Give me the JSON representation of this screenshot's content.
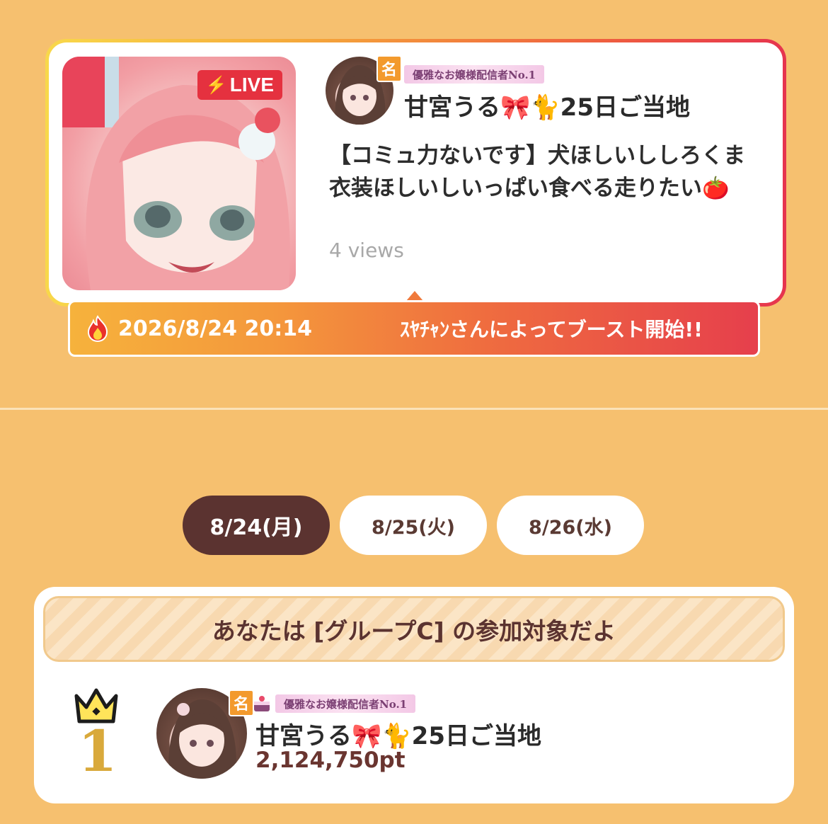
{
  "colors": {
    "background": "#f6c06f",
    "live_red": "#e5313f",
    "active_tab": "#5b3330",
    "rank_gold": "#d9a93b"
  },
  "stream": {
    "live_label": "LIVE",
    "live_icon": "lightning-bolt-icon",
    "badge_icon_text": "名",
    "title_badge": "優雅なお嬢様配信者No.1",
    "streamer_name": "甘宮うる🎀🐈25日ご当地",
    "description": "【コミュ力ないです】犬ほしいししろくま衣装ほしいしいっぱい食べる走りたい🍅",
    "views": "4 views"
  },
  "boost": {
    "icon": "fire-icon",
    "datetime": "2026/8/24 20:14",
    "message": "ｽﾔﾁｬﾝさんによってブースト開始!!"
  },
  "tabs": [
    {
      "label": "8/24(月)",
      "active": true
    },
    {
      "label": "8/25(火)",
      "active": false
    },
    {
      "label": "8/26(水)",
      "active": false
    }
  ],
  "ranking": {
    "group_message": "あなたは [グループC] の参加対象だよ",
    "entries": [
      {
        "rank": "1",
        "rank_icon": "crown-icon",
        "badge_icon_text": "名",
        "title_badge": "優雅なお嬢様配信者No.1",
        "name": "甘宮うる🎀🐈25日ご当地",
        "points": "2,124,750pt"
      }
    ]
  }
}
